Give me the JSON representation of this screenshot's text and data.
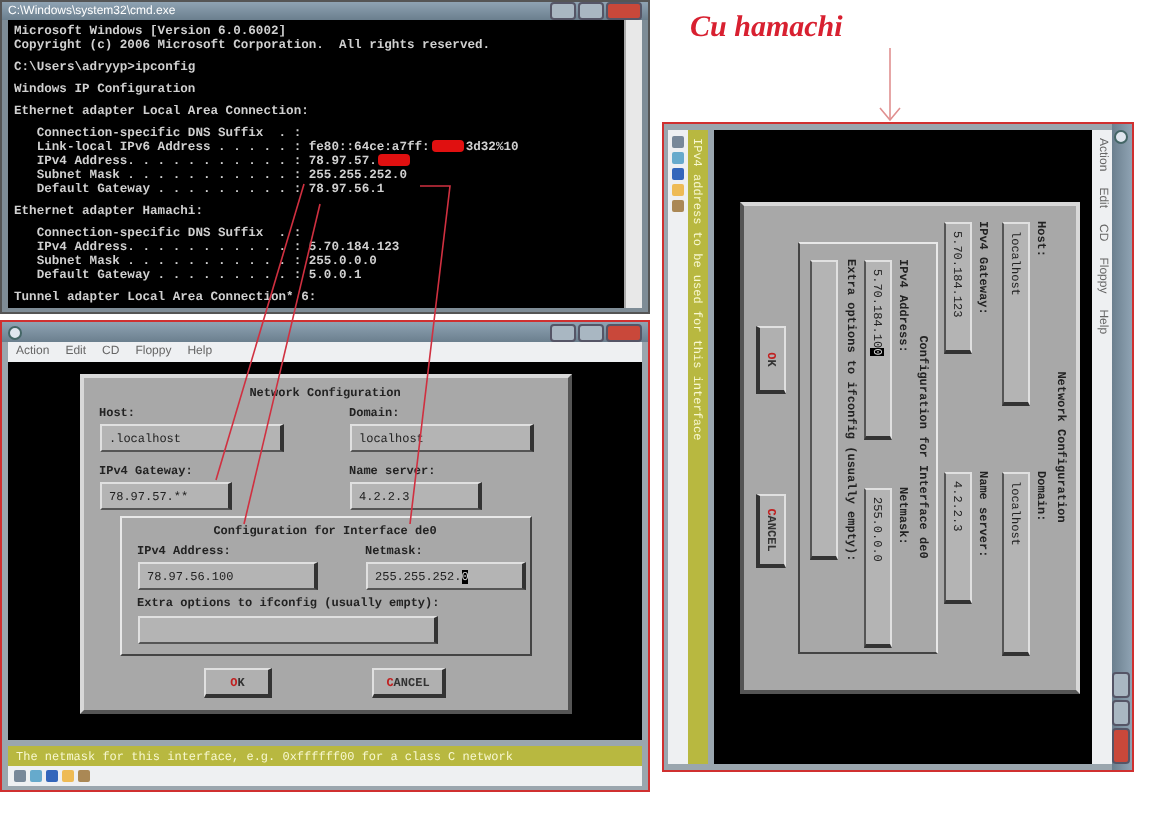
{
  "console": {
    "title": "C:\\Windows\\system32\\cmd.exe",
    "lines": [
      {
        "text": "Microsoft Windows [Version 6.0.6002]",
        "gap_before": false,
        "redacted": false
      },
      {
        "text": "Copyright (c) 2006 Microsoft Corporation.  All rights reserved.",
        "gap_before": false,
        "redacted": false
      },
      {
        "text": "C:\\Users\\adryyp>ipconfig",
        "gap_before": true,
        "redacted": false
      },
      {
        "text": "Windows IP Configuration",
        "gap_before": true,
        "redacted": false
      },
      {
        "text": "Ethernet adapter Local Area Connection:",
        "gap_before": true,
        "redacted": false
      },
      {
        "text": "   Connection-specific DNS Suffix  . :",
        "gap_before": true,
        "redacted": false
      },
      {
        "text": "   Link-local IPv6 Address . . . . . : fe80::64ce:a7ff:",
        "gap_before": false,
        "redacted": true,
        "tail": "3d32%10"
      },
      {
        "text": "   IPv4 Address. . . . . . . . . . . : 78.97.57.",
        "gap_before": false,
        "redacted": true
      },
      {
        "text": "   Subnet Mask . . . . . . . . . . . : 255.255.252.0",
        "gap_before": false,
        "redacted": false
      },
      {
        "text": "   Default Gateway . . . . . . . . . : 78.97.56.1",
        "gap_before": false,
        "redacted": false
      },
      {
        "text": "Ethernet adapter Hamachi:",
        "gap_before": true,
        "redacted": false
      },
      {
        "text": "   Connection-specific DNS Suffix  . :",
        "gap_before": true,
        "redacted": false
      },
      {
        "text": "   IPv4 Address. . . . . . . . . . . : 5.70.184.123",
        "gap_before": false,
        "redacted": false
      },
      {
        "text": "   Subnet Mask . . . . . . . . . . . : 255.0.0.0",
        "gap_before": false,
        "redacted": false
      },
      {
        "text": "   Default Gateway . . . . . . . . . : 5.0.0.1",
        "gap_before": false,
        "redacted": false
      },
      {
        "text": "Tunnel adapter Local Area Connection* 6:",
        "gap_before": true,
        "redacted": false
      }
    ]
  },
  "heading": "Cu hamachi",
  "vms": [
    {
      "rotated": false,
      "menu": [
        "Action",
        "Edit",
        "CD",
        "Floppy",
        "Help"
      ],
      "dialog": {
        "title": "Network Configuration",
        "fields": [
          {
            "label": "Host:",
            "value": ".localhost",
            "cursor": false
          },
          {
            "label": "Domain:",
            "value": "localhost",
            "cursor": false
          },
          {
            "label": "IPv4 Gateway:",
            "value": "78.97.57.**",
            "cursor": false
          },
          {
            "label": "Name server:",
            "value": "4.2.2.3",
            "cursor": false
          }
        ],
        "group": {
          "title": "Configuration for Interface de0",
          "fields": [
            {
              "label": "IPv4 Address:",
              "value": "78.97.56.100",
              "cursor": false
            },
            {
              "label": "Netmask:",
              "value": "255.255.252.0",
              "cursor": true
            }
          ],
          "extra_label": "Extra options to ifconfig (usually empty):"
        },
        "buttons": [
          "OK",
          "CANCEL"
        ]
      },
      "status": "The netmask for this interface, e.g. 0xffffff00 for a class C network"
    },
    {
      "rotated": true,
      "menu": [
        "Action",
        "Edit",
        "CD",
        "Floppy",
        "Help"
      ],
      "dialog": {
        "title": "Network Configuration",
        "fields": [
          {
            "label": "Host:",
            "value": "localhost",
            "cursor": false
          },
          {
            "label": "Domain:",
            "value": "localhost",
            "cursor": false
          },
          {
            "label": "IPv4 Gateway:",
            "value": "5.70.184.123",
            "cursor": false
          },
          {
            "label": "Name server:",
            "value": "4.2.2.3",
            "cursor": false
          }
        ],
        "group": {
          "title": "Configuration for Interface de0",
          "fields": [
            {
              "label": "IPv4 Address:",
              "value": "5.70.184.100",
              "cursor": true
            },
            {
              "label": "Netmask:",
              "value": "255.0.0.0",
              "cursor": false
            }
          ],
          "extra_label": "Extra options to ifconfig (usually empty):"
        },
        "buttons": [
          "OK",
          "CANCEL"
        ]
      },
      "status": "IPv4 address to be used for this interface"
    }
  ]
}
